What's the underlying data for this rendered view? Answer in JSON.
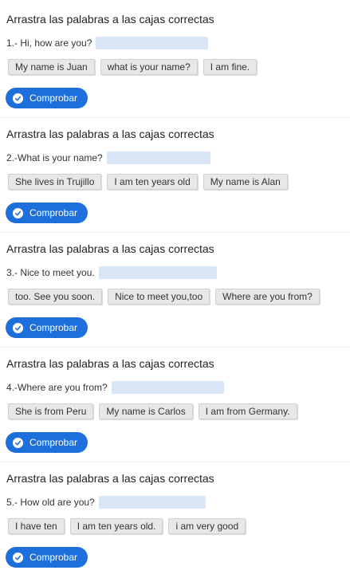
{
  "exercises": [
    {
      "instruction": "Arrastra las palabras a las cajas correctas",
      "question": "1.- Hi, how are you?",
      "options": [
        "My name is Juan",
        "what is your name?",
        "I am fine."
      ],
      "button_label": "Comprobar",
      "button_icon": "check-circle-icon"
    },
    {
      "instruction": "Arrastra las palabras a las cajas correctas",
      "question": "2.-What is your name?",
      "options": [
        "She lives in Trujillo",
        "I am ten years old",
        "My name is Alan"
      ],
      "button_label": "Comprobar",
      "button_icon": "check-circle-icon"
    },
    {
      "instruction": "Arrastra las palabras a las cajas correctas",
      "question": "3.- Nice to meet you.",
      "options": [
        "too. See you soon.",
        "Nice to meet you,too",
        "Where are you from?"
      ],
      "button_label": "Comprobar",
      "button_icon": "check-circle-icon"
    },
    {
      "instruction": "Arrastra las palabras a las cajas correctas",
      "question": "4.-Where are you from?",
      "options": [
        "She is from Peru",
        "My name is Carlos",
        "I am from Germany."
      ],
      "button_label": "Comprobar",
      "button_icon": "check-circle-icon"
    },
    {
      "instruction": "Arrastra las palabras a las cajas correctas",
      "question": "5.- How old are you?",
      "options": [
        "I have ten",
        "I am ten years old.",
        "i am very good"
      ],
      "button_label": "Comprobar",
      "button_icon": "check-circle-icon"
    }
  ],
  "colors": {
    "button": "#1d6fdc",
    "drop_box": "#d8e6f7",
    "chip": "#e8e8e8"
  }
}
